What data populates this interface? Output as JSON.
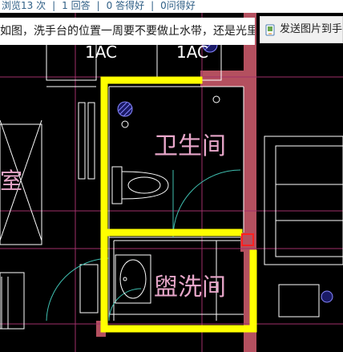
{
  "thread_stats": {
    "views": "浏览13 次",
    "answers": "1 回答",
    "good_count": "0 答得好",
    "ask_good": "0问得好",
    "separator": "|"
  },
  "question": {
    "text": "如图，洗手台的位置一周要不要做止水带，还是光里"
  },
  "toolbar": {
    "send_to_phone_label": "发送图片到手机"
  },
  "drawing": {
    "unit_label_1": "1AC",
    "unit_label_2": "1AC",
    "room_bathroom": "卫生间",
    "room_washroom": "盥洗间",
    "room_left_partial": "室",
    "highlight_color": "#ffff00",
    "wall_fill_color": "#b4505f",
    "line_color": "#ffffff",
    "text_color": "#e7a6c9"
  }
}
